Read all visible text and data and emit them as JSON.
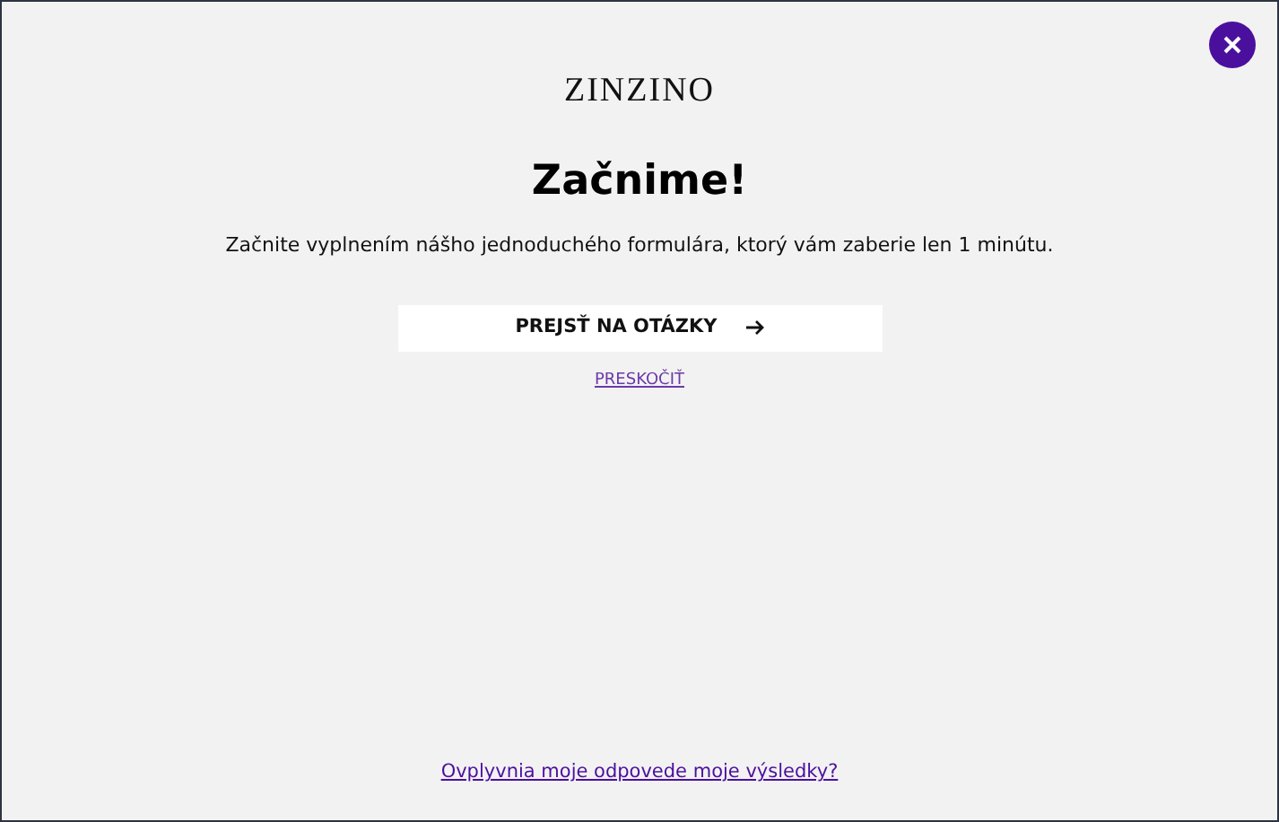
{
  "logo": "ZINZINO",
  "title": "Začnime!",
  "subtitle": "Začnite vyplnením nášho jednoduchého formulára, ktorý vám zaberie len 1 minútu.",
  "primary_button": "PREJSŤ NA OTÁZKY",
  "skip_link": "PRESKOČIŤ",
  "footer_link": "Ovplyvnia moje odpovede moje výsledky?"
}
